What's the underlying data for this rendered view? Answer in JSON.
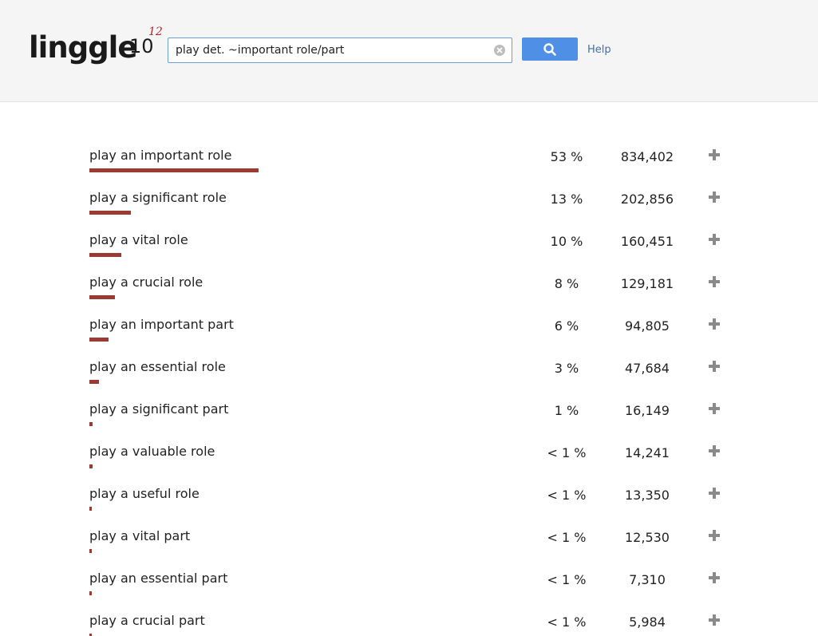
{
  "app": {
    "logo_text": "linggle",
    "logo_base": "10",
    "logo_exponent": "12"
  },
  "search": {
    "query": "play det. ~important role/part",
    "help_label": "Help"
  },
  "results": [
    {
      "phrase": "play an important role",
      "percent": "53 %",
      "percent_value": 53.0,
      "count": "834,402"
    },
    {
      "phrase": "play a significant role",
      "percent": "13 %",
      "percent_value": 13.0,
      "count": "202,856"
    },
    {
      "phrase": "play a vital role",
      "percent": "10 %",
      "percent_value": 10.0,
      "count": "160,451"
    },
    {
      "phrase": "play a crucial role",
      "percent": "8 %",
      "percent_value": 8.0,
      "count": "129,181"
    },
    {
      "phrase": "play an important part",
      "percent": "6 %",
      "percent_value": 6.0,
      "count": "94,805"
    },
    {
      "phrase": "play an essential role",
      "percent": "3 %",
      "percent_value": 3.0,
      "count": "47,684"
    },
    {
      "phrase": "play a significant part",
      "percent": "1 %",
      "percent_value": 1.0,
      "count": "16,149"
    },
    {
      "phrase": "play a valuable role",
      "percent": "< 1 %",
      "percent_value": 0.9,
      "count": "14,241"
    },
    {
      "phrase": "play a useful role",
      "percent": "< 1 %",
      "percent_value": 0.85,
      "count": "13,350"
    },
    {
      "phrase": "play a vital part",
      "percent": "< 1 %",
      "percent_value": 0.8,
      "count": "12,530"
    },
    {
      "phrase": "play an essential part",
      "percent": "< 1 %",
      "percent_value": 0.47,
      "count": "7,310"
    },
    {
      "phrase": "play a crucial part",
      "percent": "< 1 %",
      "percent_value": 0.38,
      "count": "5,984"
    }
  ],
  "colors": {
    "bar": "#9b3a33",
    "search_button": "#4f8fe6",
    "help_link": "#3d6fb4",
    "logo_exponent": "#b0282a"
  }
}
